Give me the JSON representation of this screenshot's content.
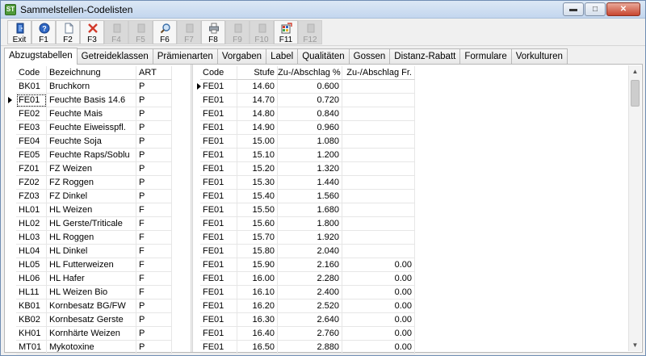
{
  "window": {
    "title": "Sammelstellen-Codelisten",
    "app_icon": "ST"
  },
  "toolbar": {
    "buttons": [
      {
        "label": "Exit",
        "icon": "exit-door-icon",
        "enabled": true
      },
      {
        "label": "F1",
        "icon": "help-icon",
        "enabled": true
      },
      {
        "label": "F2",
        "icon": "new-document-icon",
        "enabled": true
      },
      {
        "label": "F3",
        "icon": "delete-x-icon",
        "enabled": true
      },
      {
        "label": "F4",
        "icon": "",
        "enabled": false
      },
      {
        "label": "F5",
        "icon": "",
        "enabled": false
      },
      {
        "label": "F6",
        "icon": "search-icon",
        "enabled": true
      },
      {
        "label": "F7",
        "icon": "",
        "enabled": false
      },
      {
        "label": "F8",
        "icon": "print-icon",
        "enabled": true
      },
      {
        "label": "F9",
        "icon": "",
        "enabled": false
      },
      {
        "label": "F10",
        "icon": "",
        "enabled": false
      },
      {
        "label": "F11",
        "icon": "export-icon",
        "enabled": true
      },
      {
        "label": "F12",
        "icon": "",
        "enabled": false
      }
    ]
  },
  "tabs": [
    "Abzugstabellen",
    "Getreideklassen",
    "Prämienarten",
    "Vorgaben",
    "Label",
    "Qualitäten",
    "Gossen",
    "Distanz-Rabatt",
    "Formulare",
    "Vorkulturen"
  ],
  "active_tab": 0,
  "left_grid": {
    "headers": [
      "Code",
      "Bezeichnung",
      "ART"
    ],
    "selected_row": 1,
    "rows": [
      [
        "BK01",
        "Bruchkorn",
        "P"
      ],
      [
        "FE01",
        "Feuchte Basis 14.6",
        "P"
      ],
      [
        "FE02",
        "Feuchte Mais",
        "P"
      ],
      [
        "FE03",
        "Feuchte Eiweisspfl.",
        "P"
      ],
      [
        "FE04",
        "Feuchte Soja",
        "P"
      ],
      [
        "FE05",
        "Feuchte Raps/Soblu",
        "P"
      ],
      [
        "FZ01",
        "FZ Weizen",
        "P"
      ],
      [
        "FZ02",
        "FZ Roggen",
        "P"
      ],
      [
        "FZ03",
        "FZ Dinkel",
        "P"
      ],
      [
        "HL01",
        "HL Weizen",
        "F"
      ],
      [
        "HL02",
        "HL Gerste/Triticale",
        "F"
      ],
      [
        "HL03",
        "HL Roggen",
        "F"
      ],
      [
        "HL04",
        "HL Dinkel",
        "F"
      ],
      [
        "HL05",
        "HL Futterweizen",
        "F"
      ],
      [
        "HL06",
        "HL Hafer",
        "F"
      ],
      [
        "HL11",
        "HL Weizen Bio",
        "F"
      ],
      [
        "KB01",
        "Kornbesatz BG/FW",
        "P"
      ],
      [
        "KB02",
        "Kornbesatz Gerste",
        "P"
      ],
      [
        "KH01",
        "Kornhärte Weizen",
        "P"
      ],
      [
        "MT01",
        "Mykotoxine",
        "P"
      ]
    ]
  },
  "right_grid": {
    "headers": [
      "Code",
      "Stufe",
      "Zu-/Abschlag %",
      "Zu-/Abschlag Fr."
    ],
    "selected_row": 0,
    "rows": [
      [
        "FE01",
        "14.60",
        "0.600",
        ""
      ],
      [
        "FE01",
        "14.70",
        "0.720",
        ""
      ],
      [
        "FE01",
        "14.80",
        "0.840",
        ""
      ],
      [
        "FE01",
        "14.90",
        "0.960",
        ""
      ],
      [
        "FE01",
        "15.00",
        "1.080",
        ""
      ],
      [
        "FE01",
        "15.10",
        "1.200",
        ""
      ],
      [
        "FE01",
        "15.20",
        "1.320",
        ""
      ],
      [
        "FE01",
        "15.30",
        "1.440",
        ""
      ],
      [
        "FE01",
        "15.40",
        "1.560",
        ""
      ],
      [
        "FE01",
        "15.50",
        "1.680",
        ""
      ],
      [
        "FE01",
        "15.60",
        "1.800",
        ""
      ],
      [
        "FE01",
        "15.70",
        "1.920",
        ""
      ],
      [
        "FE01",
        "15.80",
        "2.040",
        ""
      ],
      [
        "FE01",
        "15.90",
        "2.160",
        "0.00"
      ],
      [
        "FE01",
        "16.00",
        "2.280",
        "0.00"
      ],
      [
        "FE01",
        "16.10",
        "2.400",
        "0.00"
      ],
      [
        "FE01",
        "16.20",
        "2.520",
        "0.00"
      ],
      [
        "FE01",
        "16.30",
        "2.640",
        "0.00"
      ],
      [
        "FE01",
        "16.40",
        "2.760",
        "0.00"
      ],
      [
        "FE01",
        "16.50",
        "2.880",
        "0.00"
      ]
    ]
  },
  "colors": {
    "titlebar": "#c3d6ee",
    "close_button": "#c8462f",
    "grid_line": "#e6e6e6"
  }
}
